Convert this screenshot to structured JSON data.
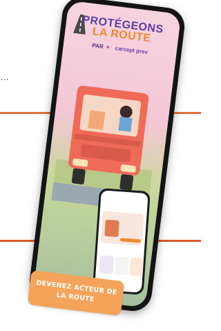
{
  "page": {
    "leading_text": "…"
  },
  "app": {
    "title_line1": "PROTÉGEONS",
    "title_line2": "LA ROUTE",
    "par": "PAR",
    "partner": "carcept prev"
  },
  "cta": {
    "label_line1": "DEVENEZ ACTEUR DE",
    "label_line2": "LA ROUTE"
  },
  "colors": {
    "accent_orange": "#f08a2c",
    "brand_purple": "#5b3ea6",
    "rule_orange": "#e46f3a",
    "truck_red": "#ef6b57"
  }
}
